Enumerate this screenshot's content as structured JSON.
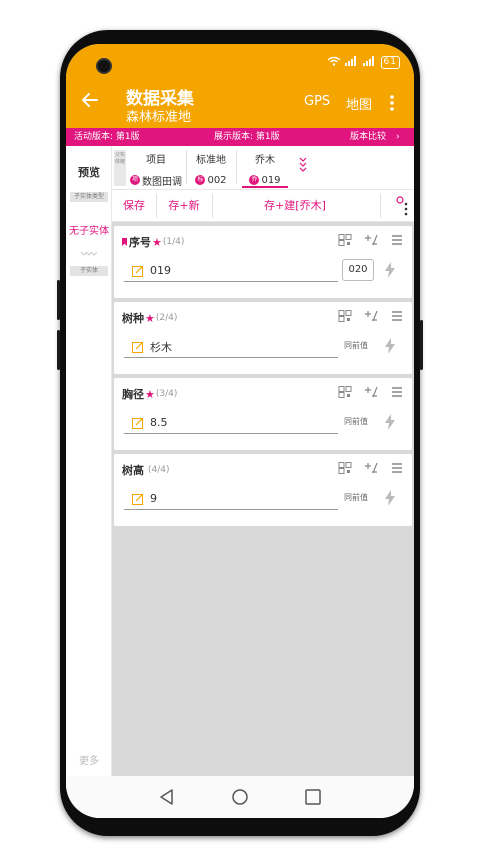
{
  "appbar": {
    "title": "数据采集",
    "subtitle": "森林标准地",
    "gps_label": "GPS",
    "map_label": "地图",
    "battery": "61",
    "color": "#f5a500"
  },
  "versionbar": {
    "active_version": "活动版本: 第1版",
    "display_version": "展示版本: 第1版",
    "compare_label": "版本比较",
    "color": "#e0157d"
  },
  "leftpane": {
    "preview_label": "预览",
    "child_type_tag": "子实体类型",
    "no_child_label": "无子实体",
    "child_tag": "子实体",
    "more_label": "更多"
  },
  "tabs": {
    "parent_label": "父实体链",
    "items": [
      {
        "label": "项目",
        "badge": "项",
        "value": "数图田调"
      },
      {
        "label": "标准地",
        "badge": "标",
        "value": "002"
      },
      {
        "label": "乔木",
        "badge": "乔",
        "value": "019"
      }
    ]
  },
  "actions": {
    "save": "保存",
    "save_new": "存+新",
    "save_build": "存+建[乔木]"
  },
  "cards": [
    {
      "title": "序号",
      "count": "(1/4)",
      "value": "019",
      "prev": "020",
      "bookmarked": true
    },
    {
      "title": "树种",
      "count": "(2/4)",
      "value": "杉木",
      "prev": "同前值"
    },
    {
      "title": "胸径",
      "count": "(3/4)",
      "value": "8.5",
      "prev": "同前值"
    },
    {
      "title": "树高",
      "count": "(4/4)",
      "value": "9",
      "prev": "同前值"
    }
  ]
}
